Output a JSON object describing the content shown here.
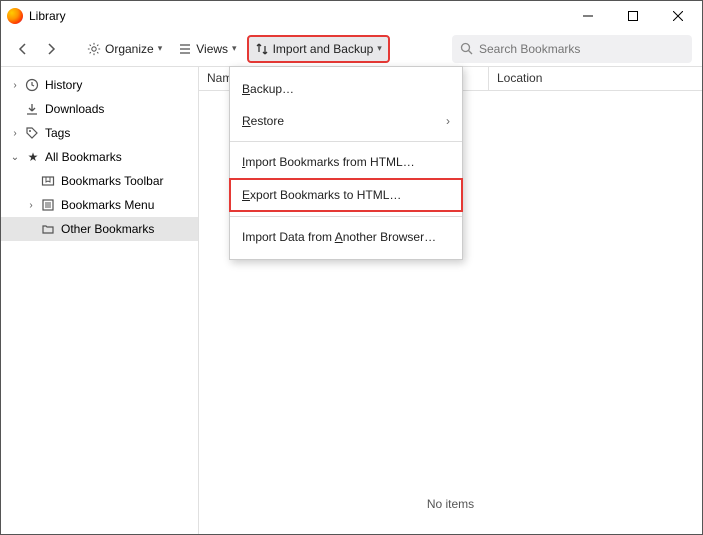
{
  "window": {
    "title": "Library"
  },
  "toolbar": {
    "organize": "Organize",
    "views": "Views",
    "import_backup": "Import and Backup"
  },
  "search": {
    "placeholder": "Search Bookmarks"
  },
  "sidebar": {
    "history": "History",
    "downloads": "Downloads",
    "tags": "Tags",
    "all_bookmarks": "All Bookmarks",
    "bookmarks_toolbar": "Bookmarks Toolbar",
    "bookmarks_menu": "Bookmarks Menu",
    "other_bookmarks": "Other Bookmarks"
  },
  "columns": {
    "name": "Name",
    "location": "Location"
  },
  "empty_state": "No items",
  "menu": {
    "backup": "Backup…",
    "restore": "Restore",
    "import_html": "Import Bookmarks from HTML…",
    "export_html": "Export Bookmarks to HTML…",
    "import_other": "Import Data from Another Browser…"
  }
}
